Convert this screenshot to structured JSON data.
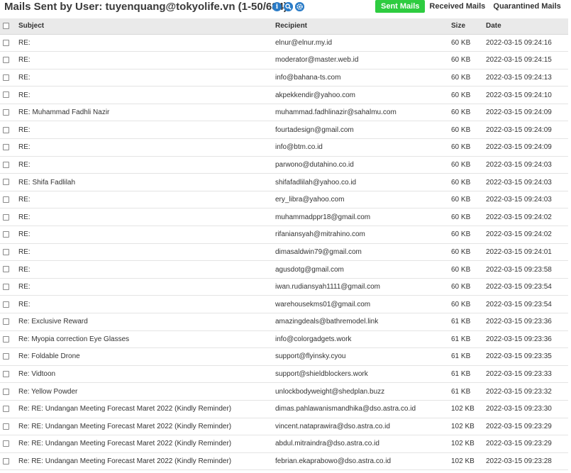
{
  "header": {
    "title": "Mails Sent by User: tuyenquang@tokyolife.vn (1-50/684)",
    "icons": [
      "info-icon",
      "zoom-icon",
      "gear-icon"
    ]
  },
  "tabs": [
    {
      "label": "Sent Mails",
      "active": true
    },
    {
      "label": "Received Mails",
      "active": false
    },
    {
      "label": "Quarantined Mails",
      "active": false
    }
  ],
  "colors": {
    "accent": "#2ecc40",
    "icon": "#2b7cc7",
    "header_bg": "#eaeaea"
  },
  "table": {
    "columns": [
      "Subject",
      "Recipient",
      "Size",
      "Date"
    ],
    "rows": [
      {
        "subject": "RE:",
        "recipient": "elnur@elnur.my.id",
        "size": "60 KB",
        "date": "2022-03-15 09:24:16"
      },
      {
        "subject": "RE:",
        "recipient": "moderator@master.web.id",
        "size": "60 KB",
        "date": "2022-03-15 09:24:15"
      },
      {
        "subject": "RE:",
        "recipient": "info@bahana-ts.com",
        "size": "60 KB",
        "date": "2022-03-15 09:24:13"
      },
      {
        "subject": "RE:",
        "recipient": "akpekkendir@yahoo.com",
        "size": "60 KB",
        "date": "2022-03-15 09:24:10"
      },
      {
        "subject": "RE: Muhammad Fadhli Nazir",
        "recipient": "muhammad.fadhlinazir@sahalmu.com",
        "size": "60 KB",
        "date": "2022-03-15 09:24:09"
      },
      {
        "subject": "RE:",
        "recipient": "fourtadesign@gmail.com",
        "size": "60 KB",
        "date": "2022-03-15 09:24:09"
      },
      {
        "subject": "RE:",
        "recipient": "info@btm.co.id",
        "size": "60 KB",
        "date": "2022-03-15 09:24:09"
      },
      {
        "subject": "RE:",
        "recipient": "parwono@dutahino.co.id",
        "size": "60 KB",
        "date": "2022-03-15 09:24:03"
      },
      {
        "subject": "RE: Shifa Fadlilah",
        "recipient": "shifafadlilah@yahoo.co.id",
        "size": "60 KB",
        "date": "2022-03-15 09:24:03"
      },
      {
        "subject": "RE:",
        "recipient": "ery_libra@yahoo.com",
        "size": "60 KB",
        "date": "2022-03-15 09:24:03"
      },
      {
        "subject": "RE:",
        "recipient": "muhammadppr18@gmail.com",
        "size": "60 KB",
        "date": "2022-03-15 09:24:02"
      },
      {
        "subject": "RE:",
        "recipient": "rifaniansyah@mitrahino.com",
        "size": "60 KB",
        "date": "2022-03-15 09:24:02"
      },
      {
        "subject": "RE:",
        "recipient": "dimasaldwin79@gmail.com",
        "size": "60 KB",
        "date": "2022-03-15 09:24:01"
      },
      {
        "subject": "RE:",
        "recipient": "agusdotg@gmail.com",
        "size": "60 KB",
        "date": "2022-03-15 09:23:58"
      },
      {
        "subject": "RE:",
        "recipient": "iwan.rudiansyah1111@gmail.com",
        "size": "60 KB",
        "date": "2022-03-15 09:23:54"
      },
      {
        "subject": "RE:",
        "recipient": "warehousekms01@gmail.com",
        "size": "60 KB",
        "date": "2022-03-15 09:23:54"
      },
      {
        "subject": "Re: Exclusive Reward",
        "recipient": "amazingdeals@bathremodel.link",
        "size": "61 KB",
        "date": "2022-03-15 09:23:36"
      },
      {
        "subject": "Re: Myopia correction Eye Glasses",
        "recipient": "info@colorgadgets.work",
        "size": "61 KB",
        "date": "2022-03-15 09:23:36"
      },
      {
        "subject": "Re: Foldable Drone",
        "recipient": "support@flyinsky.cyou",
        "size": "61 KB",
        "date": "2022-03-15 09:23:35"
      },
      {
        "subject": "Re: Vidtoon",
        "recipient": "support@shieldblockers.work",
        "size": "61 KB",
        "date": "2022-03-15 09:23:33"
      },
      {
        "subject": "Re: Yellow Powder",
        "recipient": "unlockbodyweight@shedplan.buzz",
        "size": "61 KB",
        "date": "2022-03-15 09:23:32"
      },
      {
        "subject": "Re: RE: Undangan Meeting Forecast Maret 2022 (Kindly Reminder)",
        "recipient": "dimas.pahlawanismandhika@dso.astra.co.id",
        "size": "102 KB",
        "date": "2022-03-15 09:23:30"
      },
      {
        "subject": "Re: RE: Undangan Meeting Forecast Maret 2022 (Kindly Reminder)",
        "recipient": "vincent.nataprawira@dso.astra.co.id",
        "size": "102 KB",
        "date": "2022-03-15 09:23:29"
      },
      {
        "subject": "Re: RE: Undangan Meeting Forecast Maret 2022 (Kindly Reminder)",
        "recipient": "abdul.mitraindra@dso.astra.co.id",
        "size": "102 KB",
        "date": "2022-03-15 09:23:29"
      },
      {
        "subject": "Re: RE: Undangan Meeting Forecast Maret 2022 (Kindly Reminder)",
        "recipient": "febrian.ekaprabowo@dso.astra.co.id",
        "size": "102 KB",
        "date": "2022-03-15 09:23:28"
      }
    ]
  }
}
